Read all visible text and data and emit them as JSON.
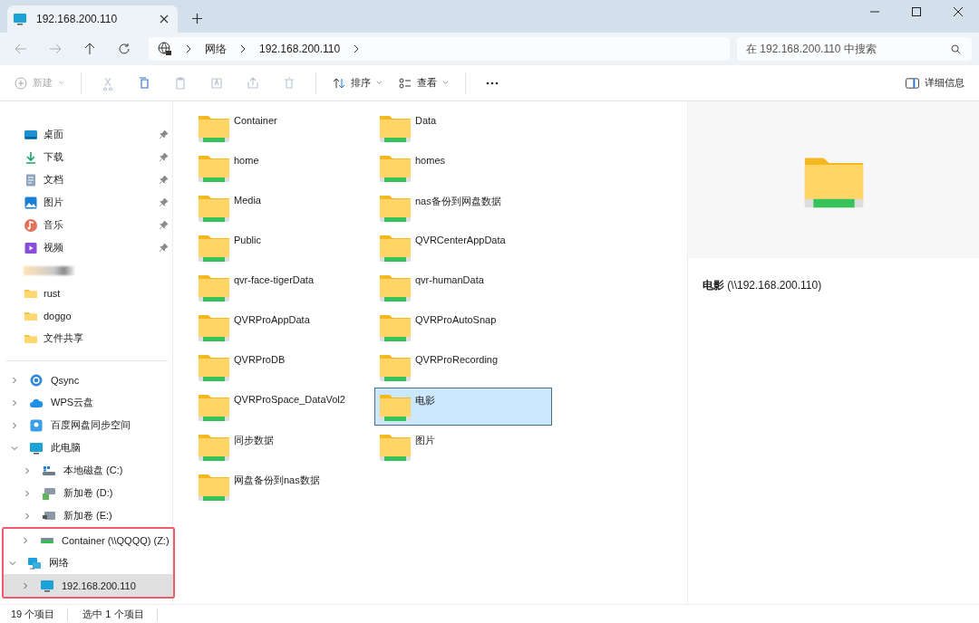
{
  "tab": {
    "title": "192.168.200.110"
  },
  "breadcrumb": [
    "网络",
    "192.168.200.110"
  ],
  "search": {
    "placeholder": "在 192.168.200.110 中搜索"
  },
  "toolbar": {
    "new": {
      "label": "新建",
      "disabled": true
    },
    "sort": "排序",
    "view": "查看",
    "details": "详细信息",
    "actions": [
      {
        "disabled": true
      },
      {
        "disabled": false
      },
      {
        "disabled": true
      },
      {
        "disabled": true
      },
      {
        "disabled": true
      },
      {
        "disabled": true
      }
    ]
  },
  "quick_access": [
    {
      "kind": "link",
      "label": "桌面",
      "pinned": true
    },
    {
      "kind": "link",
      "label": "下载",
      "pinned": true
    },
    {
      "kind": "link",
      "label": "文档",
      "pinned": true
    },
    {
      "kind": "link",
      "label": "图片",
      "pinned": true
    },
    {
      "kind": "link",
      "label": "音乐",
      "pinned": true
    },
    {
      "kind": "link",
      "label": "视频",
      "pinned": true
    },
    {
      "kind": "blurred"
    },
    {
      "kind": "link",
      "label": "rust",
      "pinned": false
    },
    {
      "kind": "link",
      "label": "doggo",
      "pinned": false
    },
    {
      "kind": "link",
      "label": "文件共享",
      "pinned": false
    }
  ],
  "tree": [
    {
      "label": "Qsync",
      "expanded": false,
      "selected": false,
      "highlighted": false
    },
    {
      "label": "WPS云盘",
      "expanded": false,
      "selected": false,
      "highlighted": false
    },
    {
      "label": "百度网盘同步空间",
      "expanded": false,
      "selected": false,
      "highlighted": false
    },
    {
      "label": "此电脑",
      "expanded": true,
      "selected": false,
      "highlighted": false,
      "children": [
        {
          "label": "本地磁盘 (C:)",
          "expanded": false,
          "selected": false,
          "highlighted": false
        },
        {
          "label": "新加卷 (D:)",
          "expanded": false,
          "selected": false,
          "highlighted": false
        },
        {
          "label": "新加卷 (E:)",
          "expanded": false,
          "selected": false,
          "highlighted": false
        },
        {
          "label": "Container (\\\\QQQQ) (Z:)",
          "expanded": false,
          "selected": false,
          "highlighted": true
        }
      ]
    },
    {
      "label": "网络",
      "expanded": true,
      "selected": false,
      "highlighted": true,
      "children": [
        {
          "label": "192.168.200.110",
          "expanded": false,
          "selected": true,
          "highlighted": true
        }
      ]
    }
  ],
  "folders": [
    {
      "name": "Container",
      "selected": false
    },
    {
      "name": "Data",
      "selected": false
    },
    {
      "name": "home",
      "selected": false
    },
    {
      "name": "homes",
      "selected": false
    },
    {
      "name": "Media",
      "selected": false
    },
    {
      "name": "nas备份到网盘数据",
      "selected": false
    },
    {
      "name": "Public",
      "selected": false
    },
    {
      "name": "QVRCenterAppData",
      "selected": false
    },
    {
      "name": "qvr-face-tigerData",
      "selected": false
    },
    {
      "name": "qvr-humanData",
      "selected": false
    },
    {
      "name": "QVRProAppData",
      "selected": false
    },
    {
      "name": "QVRProAutoSnap",
      "selected": false
    },
    {
      "name": "QVRProDB",
      "selected": false
    },
    {
      "name": "QVRProRecording",
      "selected": false
    },
    {
      "name": "QVRProSpace_DataVol2",
      "selected": false
    },
    {
      "name": "电影",
      "selected": true
    },
    {
      "name": "同步数据",
      "selected": false
    },
    {
      "name": "图片",
      "selected": false
    },
    {
      "name": "网盘备份到nas数据",
      "selected": false
    }
  ],
  "details": {
    "title": "**电影** (\\\\192.168.200.110)"
  },
  "status_bar": [
    "19 个项目",
    "选中 1 个项目"
  ]
}
